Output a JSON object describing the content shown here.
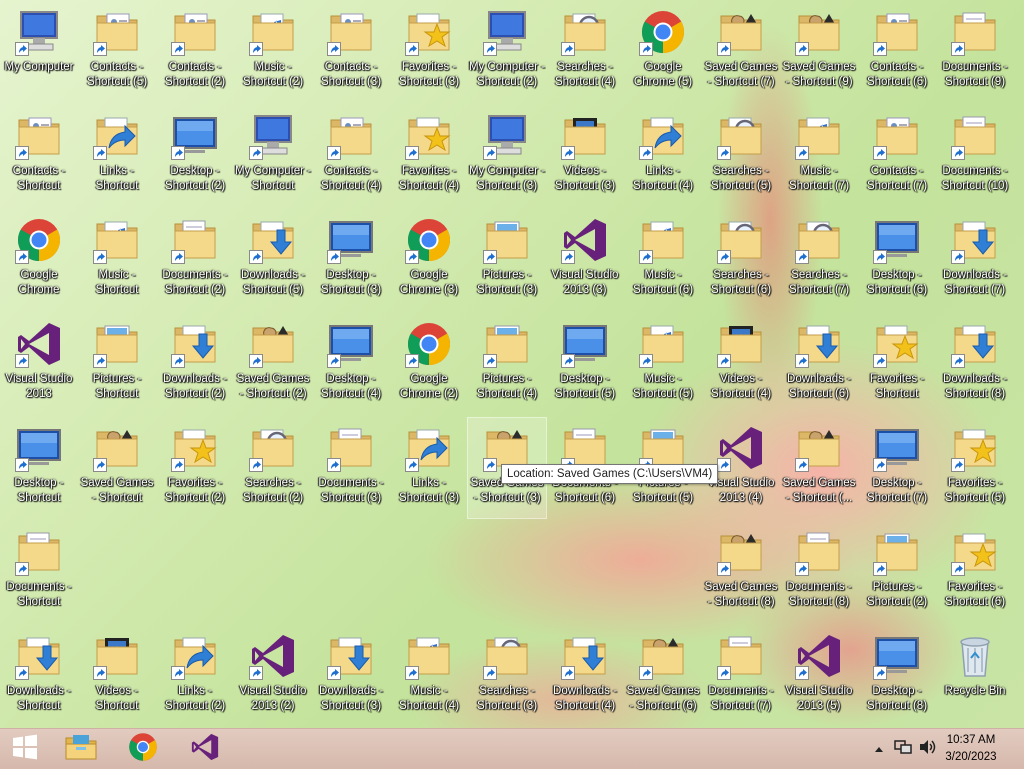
{
  "desktop": {
    "icons": [
      {
        "label": "My Computer",
        "type": "computer",
        "col": 0,
        "row": 0
      },
      {
        "label": "Contacts - Shortcut (5)",
        "type": "contacts",
        "col": 1,
        "row": 0
      },
      {
        "label": "Contacts - Shortcut (2)",
        "type": "contacts",
        "col": 2,
        "row": 0
      },
      {
        "label": "Music - Shortcut (2)",
        "type": "music",
        "col": 3,
        "row": 0
      },
      {
        "label": "Contacts - Shortcut (3)",
        "type": "contacts",
        "col": 4,
        "row": 0
      },
      {
        "label": "Favorites - Shortcut (3)",
        "type": "favorites",
        "col": 5,
        "row": 0
      },
      {
        "label": "My Computer - Shortcut (2)",
        "type": "computer",
        "col": 6,
        "row": 0
      },
      {
        "label": "Searches - Shortcut (4)",
        "type": "searches",
        "col": 7,
        "row": 0
      },
      {
        "label": "Google Chrome (5)",
        "type": "chrome",
        "col": 8,
        "row": 0
      },
      {
        "label": "Saved Games - Shortcut (7)",
        "type": "games",
        "col": 9,
        "row": 0
      },
      {
        "label": "Saved Games - Shortcut (9)",
        "type": "games",
        "col": 10,
        "row": 0
      },
      {
        "label": "Contacts - Shortcut (6)",
        "type": "contacts",
        "col": 11,
        "row": 0
      },
      {
        "label": "Documents - Shortcut (9)",
        "type": "documents",
        "col": 12,
        "row": 0
      },
      {
        "label": "Contacts - Shortcut",
        "type": "contacts",
        "col": 0,
        "row": 1
      },
      {
        "label": "Links - Shortcut",
        "type": "links",
        "col": 1,
        "row": 1
      },
      {
        "label": "Desktop - Shortcut (2)",
        "type": "desktop",
        "col": 2,
        "row": 1
      },
      {
        "label": "My Computer - Shortcut",
        "type": "computer",
        "col": 3,
        "row": 1
      },
      {
        "label": "Contacts - Shortcut (4)",
        "type": "contacts",
        "col": 4,
        "row": 1
      },
      {
        "label": "Favorites - Shortcut (4)",
        "type": "favorites",
        "col": 5,
        "row": 1
      },
      {
        "label": "My Computer - Shortcut (3)",
        "type": "computer",
        "col": 6,
        "row": 1
      },
      {
        "label": "Videos - Shortcut (3)",
        "type": "videos",
        "col": 7,
        "row": 1
      },
      {
        "label": "Links - Shortcut (4)",
        "type": "links",
        "col": 8,
        "row": 1
      },
      {
        "label": "Searches - Shortcut (5)",
        "type": "searches",
        "col": 9,
        "row": 1
      },
      {
        "label": "Music - Shortcut (7)",
        "type": "music",
        "col": 10,
        "row": 1
      },
      {
        "label": "Contacts - Shortcut (7)",
        "type": "contacts",
        "col": 11,
        "row": 1
      },
      {
        "label": "Documents - Shortcut (10)",
        "type": "documents",
        "col": 12,
        "row": 1
      },
      {
        "label": "Google Chrome",
        "type": "chrome",
        "col": 0,
        "row": 2
      },
      {
        "label": "Music - Shortcut",
        "type": "music",
        "col": 1,
        "row": 2
      },
      {
        "label": "Documents - Shortcut (2)",
        "type": "documents",
        "col": 2,
        "row": 2
      },
      {
        "label": "Downloads - Shortcut (5)",
        "type": "downloads",
        "col": 3,
        "row": 2
      },
      {
        "label": "Desktop - Shortcut (3)",
        "type": "desktop",
        "col": 4,
        "row": 2
      },
      {
        "label": "Google Chrome (3)",
        "type": "chrome",
        "col": 5,
        "row": 2
      },
      {
        "label": "Pictures - Shortcut (3)",
        "type": "pictures",
        "col": 6,
        "row": 2
      },
      {
        "label": "Visual Studio 2013 (3)",
        "type": "vs",
        "col": 7,
        "row": 2
      },
      {
        "label": "Music - Shortcut (6)",
        "type": "music",
        "col": 8,
        "row": 2
      },
      {
        "label": "Searches - Shortcut (6)",
        "type": "searches",
        "col": 9,
        "row": 2
      },
      {
        "label": "Searches - Shortcut (7)",
        "type": "searches",
        "col": 10,
        "row": 2
      },
      {
        "label": "Desktop - Shortcut (6)",
        "type": "desktop",
        "col": 11,
        "row": 2
      },
      {
        "label": "Downloads - Shortcut (7)",
        "type": "downloads",
        "col": 12,
        "row": 2
      },
      {
        "label": "Visual Studio 2013",
        "type": "vs",
        "col": 0,
        "row": 3
      },
      {
        "label": "Pictures - Shortcut",
        "type": "pictures",
        "col": 1,
        "row": 3
      },
      {
        "label": "Downloads - Shortcut (2)",
        "type": "downloads",
        "col": 2,
        "row": 3
      },
      {
        "label": "Saved Games - Shortcut (2)",
        "type": "games",
        "col": 3,
        "row": 3
      },
      {
        "label": "Desktop - Shortcut (4)",
        "type": "desktop",
        "col": 4,
        "row": 3
      },
      {
        "label": "Google Chrome (2)",
        "type": "chrome",
        "col": 5,
        "row": 3
      },
      {
        "label": "Pictures - Shortcut (4)",
        "type": "pictures",
        "col": 6,
        "row": 3
      },
      {
        "label": "Desktop - Shortcut (5)",
        "type": "desktop",
        "col": 7,
        "row": 3
      },
      {
        "label": "Music - Shortcut (5)",
        "type": "music",
        "col": 8,
        "row": 3
      },
      {
        "label": "Videos - Shortcut (4)",
        "type": "videos",
        "col": 9,
        "row": 3
      },
      {
        "label": "Downloads - Shortcut (6)",
        "type": "downloads",
        "col": 10,
        "row": 3
      },
      {
        "label": "Favorites - Shortcut",
        "type": "favorites",
        "col": 11,
        "row": 3
      },
      {
        "label": "Downloads - Shortcut (8)",
        "type": "downloads",
        "col": 12,
        "row": 3
      },
      {
        "label": "Desktop - Shortcut",
        "type": "desktop",
        "col": 0,
        "row": 4
      },
      {
        "label": "Saved Games - Shortcut",
        "type": "games",
        "col": 1,
        "row": 4
      },
      {
        "label": "Favorites - Shortcut (2)",
        "type": "favorites",
        "col": 2,
        "row": 4
      },
      {
        "label": "Searches - Shortcut (2)",
        "type": "searches",
        "col": 3,
        "row": 4
      },
      {
        "label": "Documents - Shortcut (3)",
        "type": "documents",
        "col": 4,
        "row": 4
      },
      {
        "label": "Links - Shortcut (3)",
        "type": "links",
        "col": 5,
        "row": 4
      },
      {
        "label": "Saved Games - Shortcut (3)",
        "type": "games",
        "col": 6,
        "row": 4,
        "hover": true
      },
      {
        "label": "Documents - Shortcut (6)",
        "type": "documents",
        "col": 7,
        "row": 4
      },
      {
        "label": "Pictures - Shortcut (5)",
        "type": "pictures",
        "col": 8,
        "row": 4
      },
      {
        "label": "Visual Studio 2013 (4)",
        "type": "vs",
        "col": 9,
        "row": 4
      },
      {
        "label": "Saved Games - Shortcut (...",
        "type": "games",
        "col": 10,
        "row": 4
      },
      {
        "label": "Desktop - Shortcut (7)",
        "type": "desktop",
        "col": 11,
        "row": 4
      },
      {
        "label": "Favorites - Shortcut (5)",
        "type": "favorites",
        "col": 12,
        "row": 4
      },
      {
        "label": "Documents - Shortcut",
        "type": "documents",
        "col": 0,
        "row": 5
      },
      {
        "label": "Saved Games - Shortcut (8)",
        "type": "games",
        "col": 9,
        "row": 5
      },
      {
        "label": "Documents - Shortcut (8)",
        "type": "documents",
        "col": 10,
        "row": 5
      },
      {
        "label": "Pictures - Shortcut (2)",
        "type": "pictures",
        "col": 11,
        "row": 5
      },
      {
        "label": "Favorites - Shortcut (6)",
        "type": "favorites",
        "col": 12,
        "row": 5
      },
      {
        "label": "Downloads - Shortcut",
        "type": "downloads",
        "col": 0,
        "row": 6
      },
      {
        "label": "Videos - Shortcut",
        "type": "videos",
        "col": 1,
        "row": 6
      },
      {
        "label": "Links - Shortcut (2)",
        "type": "links",
        "col": 2,
        "row": 6
      },
      {
        "label": "Visual Studio 2013 (2)",
        "type": "vs",
        "col": 3,
        "row": 6
      },
      {
        "label": "Downloads - Shortcut (3)",
        "type": "downloads",
        "col": 4,
        "row": 6
      },
      {
        "label": "Music - Shortcut (4)",
        "type": "music",
        "col": 5,
        "row": 6
      },
      {
        "label": "Searches - Shortcut (3)",
        "type": "searches",
        "col": 6,
        "row": 6
      },
      {
        "label": "Downloads - Shortcut (4)",
        "type": "downloads",
        "col": 7,
        "row": 6
      },
      {
        "label": "Saved Games - Shortcut (6)",
        "type": "games",
        "col": 8,
        "row": 6
      },
      {
        "label": "Documents - Shortcut (7)",
        "type": "documents",
        "col": 9,
        "row": 6
      },
      {
        "label": "Visual Studio 2013 (5)",
        "type": "vs",
        "col": 10,
        "row": 6
      },
      {
        "label": "Desktop - Shortcut (8)",
        "type": "desktop",
        "col": 11,
        "row": 6
      },
      {
        "label": "Recycle Bin",
        "type": "recycle",
        "col": 12,
        "row": 6
      }
    ],
    "tooltip": "Location: Saved Games (C:\\Users\\VM4)"
  },
  "taskbar": {
    "start_icon": "windows-logo-icon",
    "pinned": [
      "file-explorer-icon",
      "google-chrome-icon",
      "visual-studio-icon"
    ],
    "tray_icons": [
      "show-hidden-icons-chevron",
      "network-icon",
      "volume-icon"
    ],
    "clock_time": "10:37 AM",
    "clock_date": "3/20/2023"
  },
  "colors": {
    "taskbar": "#d9bdb1",
    "vs_purple": "#68217a"
  }
}
